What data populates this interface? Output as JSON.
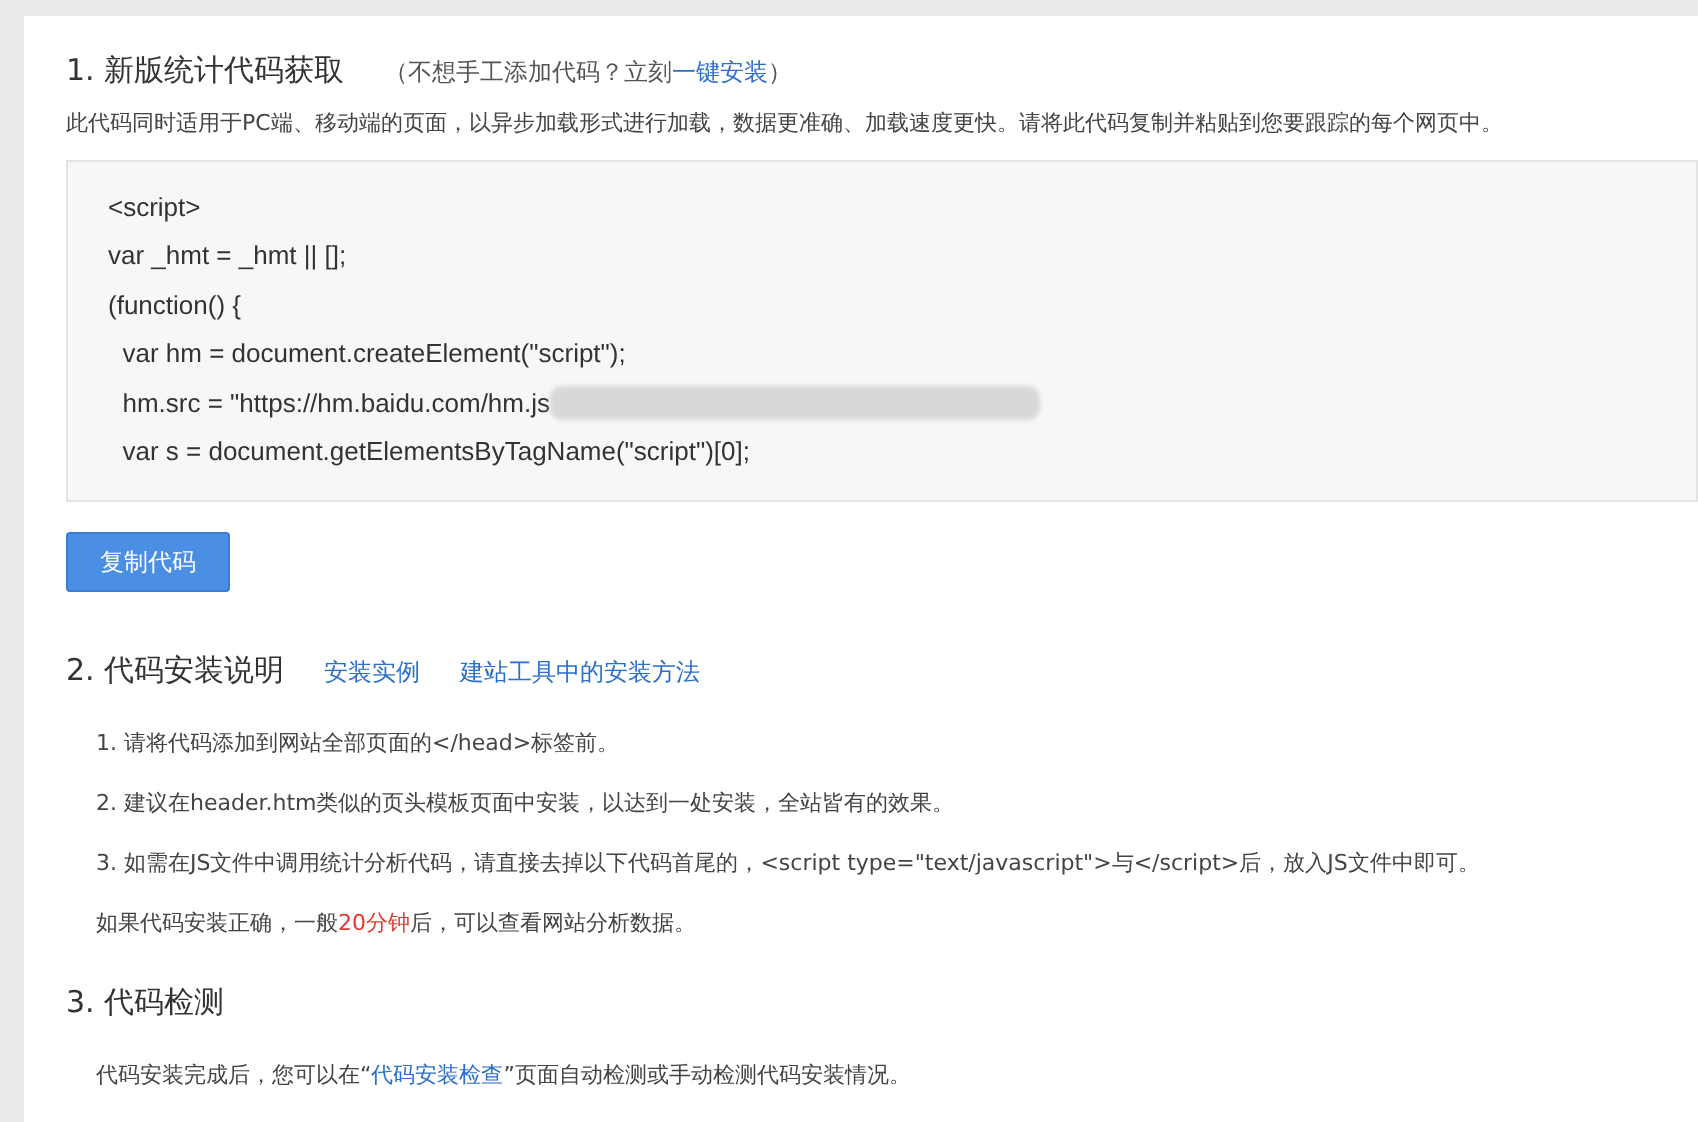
{
  "section_1": {
    "title": "1. 新版统计代码获取",
    "hint": {
      "before": "（不想手工添加代码？立刻",
      "link": "一键安装",
      "after": "）"
    },
    "description": "此代码同时适用于PC端、移动端的页面，以异步加载形式进行加载，数据更准确、加载速度更快。请将此代码复制并粘贴到您要跟踪的每个网页中。",
    "code_lines": [
      {
        "text": "<script>",
        "redacted": false
      },
      {
        "text": "var _hmt = _hmt || [];",
        "redacted": false
      },
      {
        "text": "(function() {",
        "redacted": false
      },
      {
        "text": "  var hm = document.createElement(\"script\");",
        "redacted": false
      },
      {
        "text": "  hm.src = \"https://hm.baidu.com/hm.js",
        "redacted": true
      },
      {
        "text": "  var s = document.getElementsByTagName(\"script\")[0];",
        "redacted": false
      }
    ],
    "copy_button": "复制代码"
  },
  "section_2": {
    "title": "2. 代码安装说明",
    "links": [
      "安装实例",
      "建站工具中的安装方法"
    ],
    "steps": [
      "1. 请将代码添加到网站全部页面的</head>标签前。",
      "2. 建议在header.htm类似的页头模板页面中安装，以达到一处安装，全站皆有的效果。",
      "3. 如需在JS文件中调用统计分析代码，请直接去掉以下代码首尾的，<script type=\"text/javascript\">与</script>后，放入JS文件中即可。"
    ],
    "note": {
      "before": "如果代码安装正确，一般",
      "highlight": "20分钟",
      "after": "后，可以查看网站分析数据。"
    }
  },
  "section_3": {
    "title": "3. 代码检测",
    "text": {
      "before": "代码安装完成后，您可以在“",
      "link": "代码安装检查",
      "after": "”页面自动检测或手动检测代码安装情况。"
    }
  }
}
